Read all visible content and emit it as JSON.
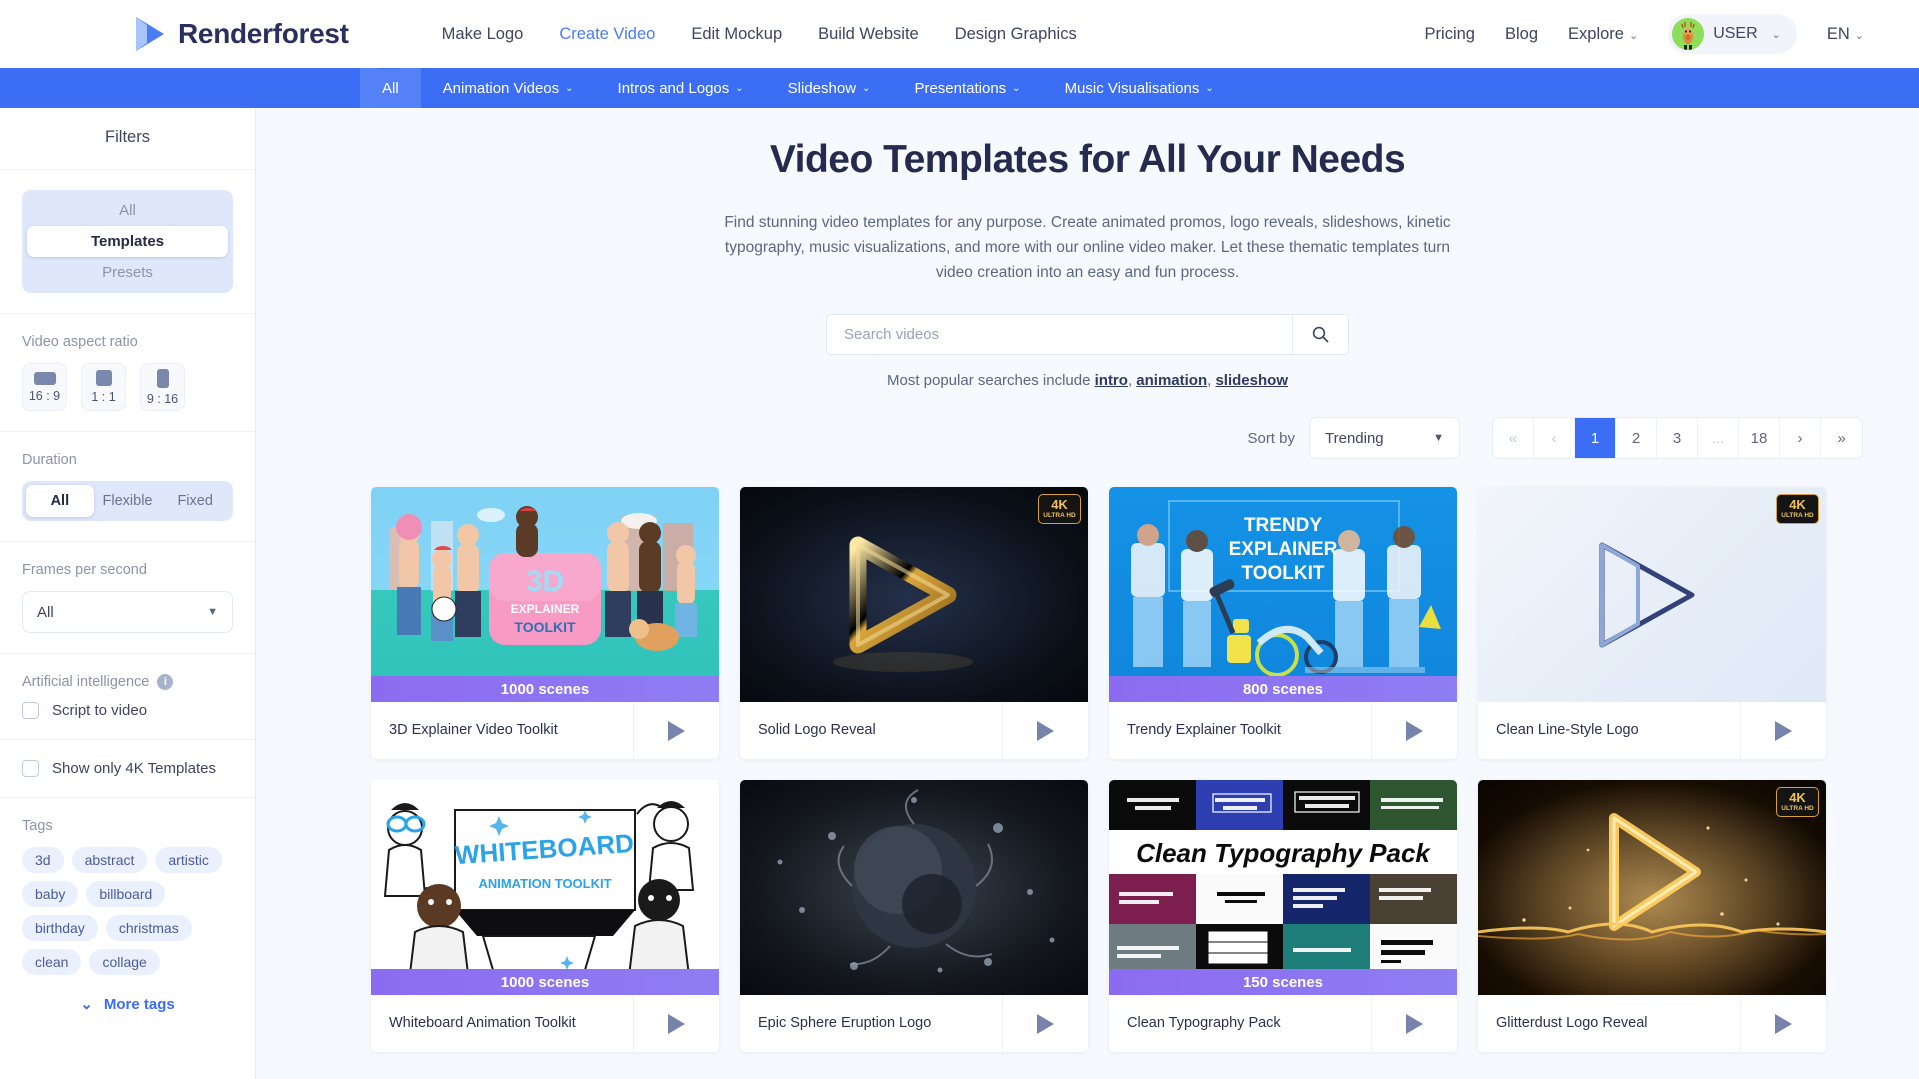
{
  "header": {
    "brand": "Renderforest",
    "nav": [
      {
        "label": "Make Logo",
        "active": false
      },
      {
        "label": "Create Video",
        "active": true
      },
      {
        "label": "Edit Mockup",
        "active": false
      },
      {
        "label": "Build Website",
        "active": false
      },
      {
        "label": "Design Graphics",
        "active": false
      }
    ],
    "pricing": "Pricing",
    "blog": "Blog",
    "explore": "Explore",
    "user": "USER",
    "lang": "EN",
    "caret": "⌄"
  },
  "categories": [
    {
      "label": "All",
      "active": true,
      "caret": false
    },
    {
      "label": "Animation Videos",
      "active": false,
      "caret": true
    },
    {
      "label": "Intros and Logos",
      "active": false,
      "caret": true
    },
    {
      "label": "Slideshow",
      "active": false,
      "caret": true
    },
    {
      "label": "Presentations",
      "active": false,
      "caret": true
    },
    {
      "label": "Music Visualisations",
      "active": false,
      "caret": true
    }
  ],
  "sidebar": {
    "title": "Filters",
    "type_options": [
      {
        "label": "All",
        "active": false
      },
      {
        "label": "Templates",
        "active": true
      },
      {
        "label": "Presets",
        "active": false
      }
    ],
    "aspect_label": "Video aspect ratio",
    "aspect_options": [
      {
        "label": "16 : 9",
        "w": 22,
        "h": 13
      },
      {
        "label": "1 : 1",
        "w": 16,
        "h": 16
      },
      {
        "label": "9 : 16",
        "w": 12,
        "h": 19
      }
    ],
    "duration_label": "Duration",
    "duration_options": [
      {
        "label": "All",
        "active": true
      },
      {
        "label": "Flexible",
        "active": false
      },
      {
        "label": "Fixed",
        "active": false
      }
    ],
    "fps_label": "Frames per second",
    "fps_value": "All",
    "ai_label": "Artificial intelligence",
    "ai_info_icon": "info-icon",
    "script_to_video": "Script to video",
    "only_4k": "Show only 4K Templates",
    "tags_label": "Tags",
    "tags": [
      "3d",
      "abstract",
      "artistic",
      "baby",
      "billboard",
      "birthday",
      "christmas",
      "clean",
      "collage"
    ],
    "more_tags": "More tags"
  },
  "hero": {
    "title": "Video Templates for All Your Needs",
    "description": "Find stunning video templates for any purpose. Create animated promos, logo reveals, slideshows, kinetic typography, music visualizations, and more with our online video maker. Let these thematic templates turn video creation into an easy and fun process.",
    "search_placeholder": "Search videos",
    "search_value": "",
    "search_icon": "search-icon",
    "popular_prefix": "Most popular searches include",
    "popular_links": [
      "intro",
      "animation",
      "slideshow"
    ]
  },
  "toolbar": {
    "sort_label": "Sort by",
    "sort_value": "Trending",
    "pagination": [
      {
        "label": "«",
        "kind": "dim"
      },
      {
        "label": "‹",
        "kind": "dim"
      },
      {
        "label": "1",
        "kind": "active"
      },
      {
        "label": "2",
        "kind": "normal"
      },
      {
        "label": "3",
        "kind": "normal"
      },
      {
        "label": "...",
        "kind": "dim"
      },
      {
        "label": "18",
        "kind": "normal"
      },
      {
        "label": "›",
        "kind": "normal"
      },
      {
        "label": "»",
        "kind": "normal"
      }
    ]
  },
  "cards": [
    {
      "title": "3D Explainer Video Toolkit",
      "scenes": "1000 scenes",
      "badge4k": false,
      "art": "t1"
    },
    {
      "title": "Solid Logo Reveal",
      "scenes": "",
      "badge4k": true,
      "art": "t2"
    },
    {
      "title": "Trendy Explainer Toolkit",
      "scenes": "800 scenes",
      "badge4k": false,
      "art": "t3"
    },
    {
      "title": "Clean Line-Style Logo",
      "scenes": "",
      "badge4k": true,
      "art": "t4"
    },
    {
      "title": "Whiteboard Animation Toolkit",
      "scenes": "1000 scenes",
      "badge4k": false,
      "art": "t5"
    },
    {
      "title": "Epic Sphere Eruption Logo",
      "scenes": "",
      "badge4k": false,
      "art": "t6"
    },
    {
      "title": "Clean Typography Pack",
      "scenes": "150 scenes",
      "badge4k": false,
      "art": "t7"
    },
    {
      "title": "Glitterdust Logo Reveal",
      "scenes": "",
      "badge4k": true,
      "art": "t8"
    }
  ],
  "badge": {
    "line1": "4K",
    "line2": "ULTRA HD"
  },
  "colors": {
    "brand_blue": "#3b6ef5",
    "scene_purple": "#8b6cf0",
    "gold": "#f0c257",
    "dark_navy": "#252b4e"
  }
}
